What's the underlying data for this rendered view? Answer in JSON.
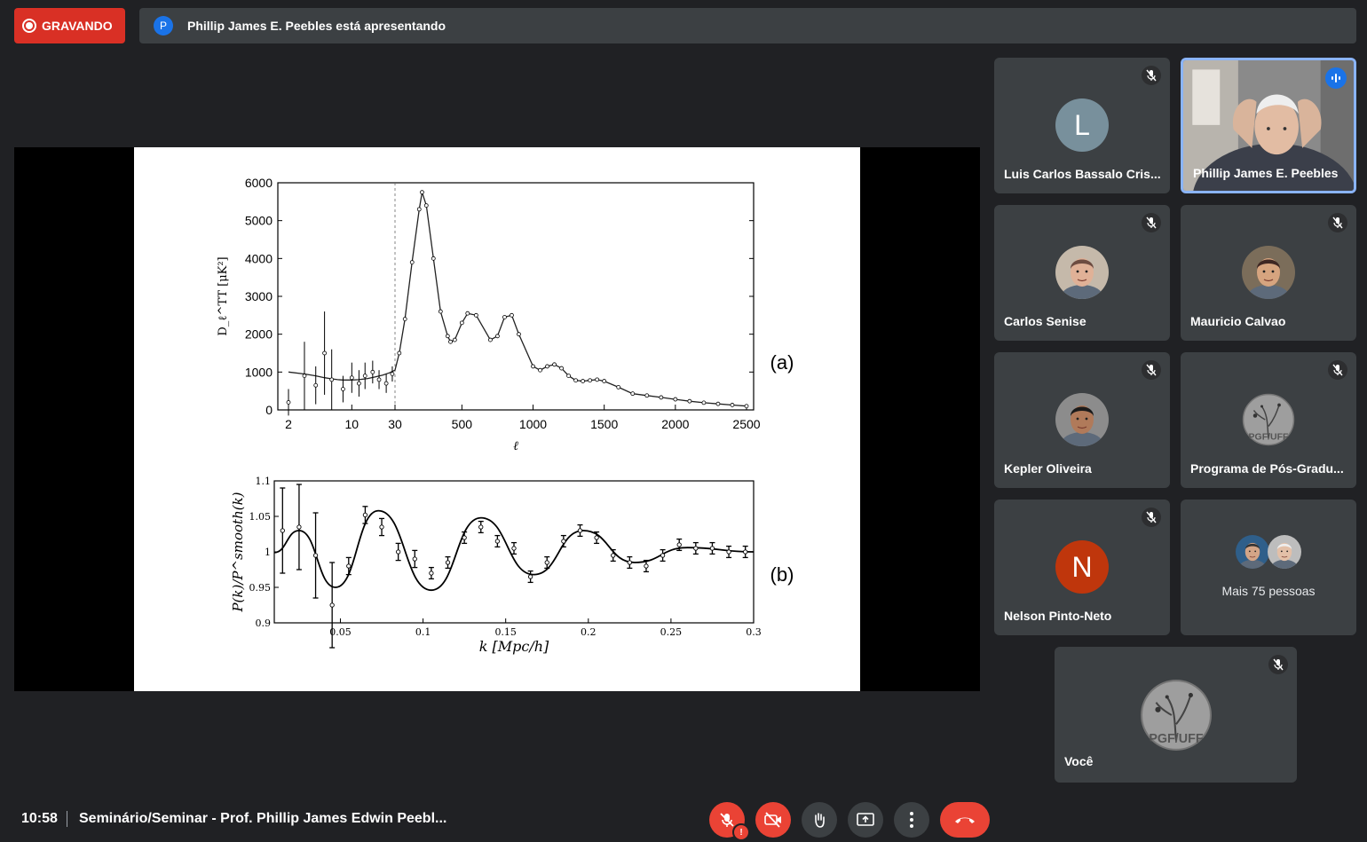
{
  "recording": {
    "label": "GRAVANDO",
    "color": "#d93025"
  },
  "presenter_bar": {
    "avatar_letter": "P",
    "text": "Phillip James E. Peebles está apresentando"
  },
  "slide": {
    "panel_a_label": "(a)",
    "panel_b_label": "(b)",
    "chart_data": [
      {
        "type": "scatter",
        "ylabel": "D_ℓ^TT [μK²]",
        "xlabel": "ℓ",
        "x_ticks": [
          "2",
          "10",
          "30",
          "500",
          "1000",
          "1500",
          "2000",
          "2500"
        ],
        "y_ticks": [
          "0",
          "1000",
          "2000",
          "3000",
          "4000",
          "5000",
          "6000"
        ],
        "ylim": [
          0,
          6000
        ],
        "x_scale": "log for ℓ ≤ 30, linear for ℓ > 30",
        "x": [
          2,
          3,
          4,
          5,
          6,
          7,
          8,
          10,
          12,
          15,
          18,
          22,
          26,
          30,
          60,
          100,
          150,
          200,
          220,
          250,
          300,
          350,
          400,
          420,
          450,
          500,
          540,
          600,
          700,
          750,
          800,
          850,
          900,
          1000,
          1050,
          1100,
          1150,
          1200,
          1250,
          1300,
          1350,
          1400,
          1450,
          1500,
          1600,
          1700,
          1800,
          1900,
          2000,
          2100,
          2200,
          2300,
          2400,
          2500
        ],
        "y": [
          1000,
          950,
          900,
          850,
          820,
          800,
          790,
          790,
          800,
          830,
          870,
          920,
          980,
          1050,
          1500,
          2400,
          3900,
          5300,
          5750,
          5400,
          4000,
          2600,
          1950,
          1800,
          1850,
          2300,
          2550,
          2500,
          1850,
          1950,
          2450,
          2500,
          2000,
          1150,
          1050,
          1150,
          1200,
          1100,
          900,
          780,
          760,
          780,
          800,
          760,
          600,
          430,
          380,
          330,
          280,
          230,
          190,
          160,
          130,
          100
        ]
      },
      {
        "type": "line",
        "ylabel": "P(k)/P^smooth(k)",
        "xlabel": "k [Mpc/h]",
        "x_ticks": [
          "0.05",
          "0.1",
          "0.15",
          "0.2",
          "0.25",
          "0.3"
        ],
        "y_ticks": [
          "0.9",
          "0.95",
          "1",
          "1.05",
          "1.1"
        ],
        "xlim": [
          0.01,
          0.3
        ],
        "ylim": [
          0.9,
          1.1
        ],
        "series": [
          {
            "name": "",
            "x": [
              0.01,
              0.025,
              0.047,
              0.073,
              0.105,
              0.135,
              0.167,
              0.197,
              0.228,
              0.26,
              0.3
            ],
            "y": [
              0.999,
              1.03,
              0.95,
              1.058,
              0.946,
              1.048,
              0.968,
              1.03,
              0.985,
              1.006,
              1.0
            ]
          },
          {
            "name": "",
            "x": [
              0.015,
              0.025,
              0.035,
              0.045,
              0.055,
              0.065,
              0.075,
              0.085,
              0.095,
              0.105,
              0.115,
              0.125,
              0.135,
              0.145,
              0.155,
              0.165,
              0.175,
              0.185,
              0.195,
              0.205,
              0.215,
              0.225,
              0.235,
              0.245,
              0.255,
              0.265,
              0.275,
              0.285,
              0.295
            ],
            "y": [
              1.03,
              1.035,
              0.995,
              0.925,
              0.98,
              1.052,
              1.035,
              1.0,
              0.99,
              0.97,
              0.985,
              1.02,
              1.035,
              1.015,
              1.005,
              0.965,
              0.985,
              1.015,
              1.03,
              1.02,
              0.995,
              0.985,
              0.98,
              0.995,
              1.01,
              1.005,
              1.005,
              1.0,
              1.0
            ]
          }
        ]
      }
    ]
  },
  "participants": [
    {
      "name": "Luis Carlos Bassalo Cris...",
      "avatar_letter": "L",
      "avatar_color": "#78909c",
      "kind": "letter"
    },
    {
      "name": "Phillip James E. Peebles",
      "kind": "video",
      "speaking": true
    },
    {
      "name": "Carlos Senise",
      "kind": "photo"
    },
    {
      "name": "Mauricio Calvao",
      "kind": "photo"
    },
    {
      "name": "Kepler Oliveira",
      "kind": "photo"
    },
    {
      "name": "Programa de Pós-Gradu...",
      "kind": "logo"
    },
    {
      "name": "Nelson Pinto-Neto",
      "avatar_letter": "N",
      "avatar_color": "#bf360c",
      "kind": "letter"
    },
    {
      "more_label": "Mais 75 pessoas",
      "kind": "more"
    },
    {
      "name": "Você",
      "kind": "logo"
    }
  ],
  "bottom_bar": {
    "time": "10:58",
    "meeting_title": "Seminário/Seminar - Prof. Phillip James Edwin Peebl...",
    "controls": [
      "mic-off",
      "camera-off",
      "raise-hand",
      "present",
      "more-options",
      "leave-call"
    ]
  }
}
